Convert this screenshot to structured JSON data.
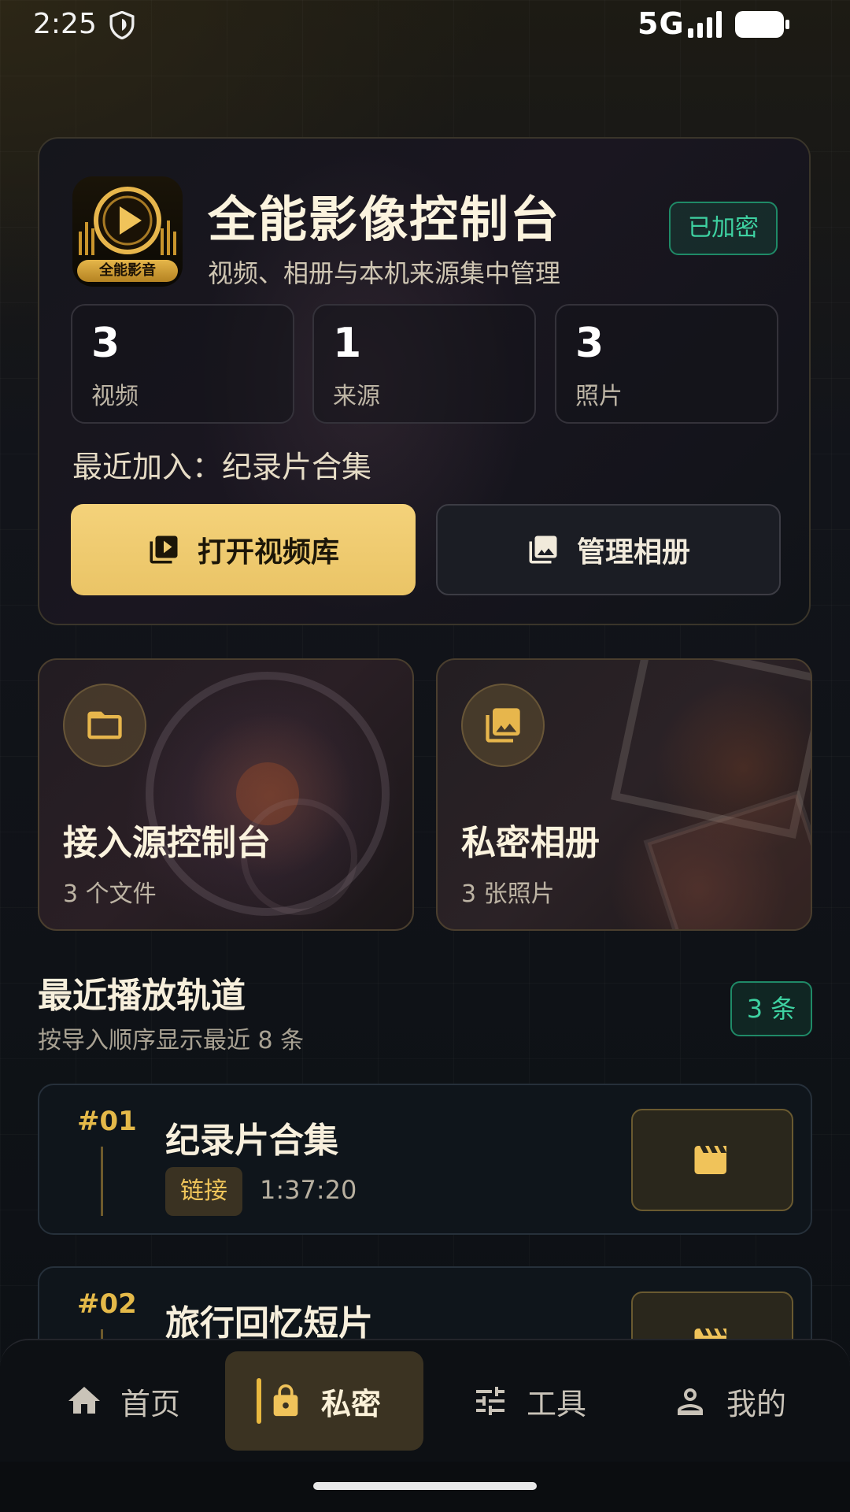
{
  "status_bar": {
    "time": "2:25",
    "network": "5G"
  },
  "hero": {
    "app_icon_label": "全能影音",
    "title": "全能影像控制台",
    "subtitle": "视频、相册与本机来源集中管理",
    "badge": "已加密",
    "stats": [
      {
        "value": "3",
        "label": "视频"
      },
      {
        "value": "1",
        "label": "来源"
      },
      {
        "value": "3",
        "label": "照片"
      }
    ],
    "recent_added": "最近加入：纪录片合集",
    "primary_button": "打开视频库",
    "secondary_button": "管理相册"
  },
  "features": [
    {
      "title": "接入源控制台",
      "subtitle": "3 个文件",
      "icon": "folder-icon"
    },
    {
      "title": "私密相册",
      "subtitle": "3 张照片",
      "icon": "photo-library-icon"
    }
  ],
  "recent_section": {
    "title": "最近播放轨道",
    "subtitle": "按导入顺序显示最近 8 条",
    "count_badge": "3 条"
  },
  "tracks": [
    {
      "index": "#01",
      "title": "纪录片合集",
      "tag": "链接",
      "duration": "1:37:20"
    },
    {
      "index": "#02",
      "title": "旅行回忆短片"
    }
  ],
  "bottom_nav": {
    "items": [
      {
        "label": "首页",
        "icon": "home-icon"
      },
      {
        "label": "私密",
        "icon": "lock-icon",
        "active": true
      },
      {
        "label": "工具",
        "icon": "tune-icon"
      },
      {
        "label": "我的",
        "icon": "person-icon"
      }
    ]
  },
  "colors": {
    "accent_gold": "#eac466",
    "accent_green": "#3ed1a1",
    "background": "#0c1014"
  }
}
